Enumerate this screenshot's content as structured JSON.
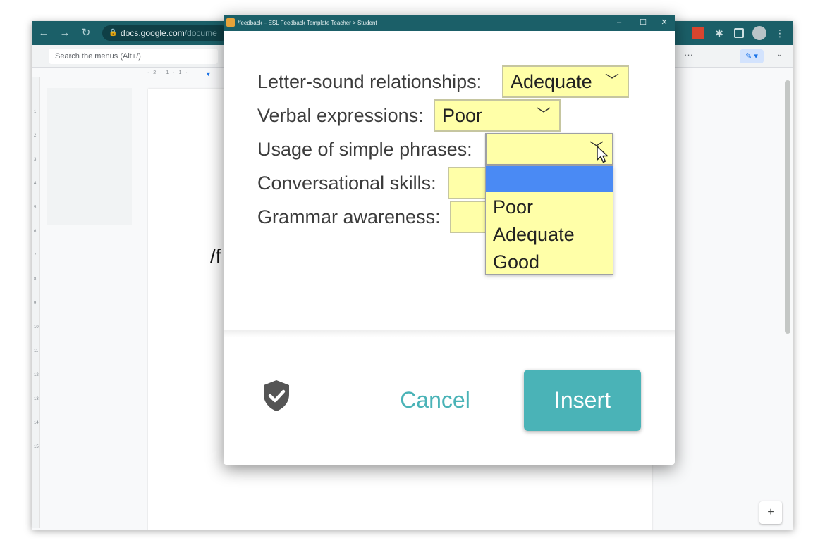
{
  "browser": {
    "url_host": "docs.google.com",
    "url_path": "/docume",
    "menu_search_placeholder": "Search the menus (Alt+/)",
    "more_label": "···",
    "ruler_text": "· 2 · 1 · 1 ·",
    "vertical_ruler": [
      "1",
      "2",
      "3",
      "4",
      "5",
      "6",
      "7",
      "8",
      "9",
      "10",
      "11",
      "12",
      "13",
      "14",
      "15"
    ],
    "doc_text": "/f"
  },
  "dialog": {
    "title": "/feedback – ESL Feedback Template Teacher > Student",
    "accent_color": "#4ab3b7",
    "fields": [
      {
        "label": "Letter-sound relationships:",
        "value": "Adequate"
      },
      {
        "label": "Verbal expressions:",
        "value": "Poor"
      },
      {
        "label": "Usage of simple phrases:",
        "value": ""
      },
      {
        "label": "Conversational skills:",
        "value": ""
      },
      {
        "label": "Grammar awareness:",
        "value": ""
      }
    ],
    "open_dropdown_options": [
      "",
      "Poor",
      "Adequate",
      "Good"
    ],
    "cancel_label": "Cancel",
    "insert_label": "Insert"
  }
}
